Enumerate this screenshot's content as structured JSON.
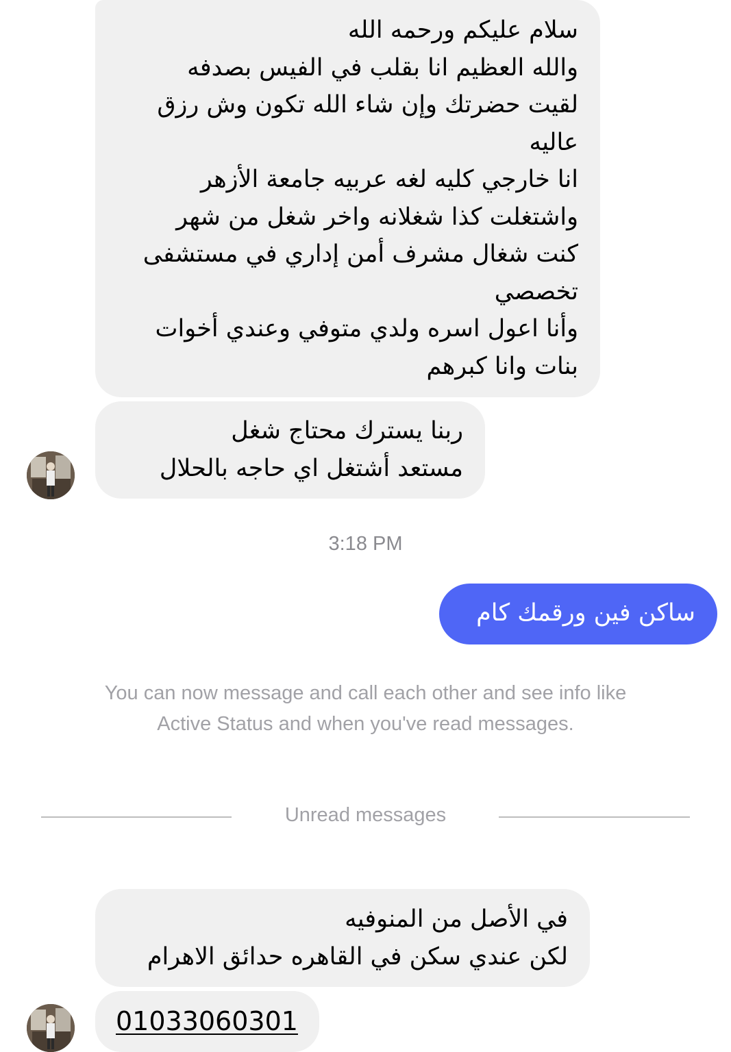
{
  "messages": {
    "incoming_1": {
      "lines": [
        "سلام عليكم ورحمه الله",
        "والله العظيم انا بقلب في الفيس بصدفه",
        "لقيت حضرتك وإن شاء الله تكون وش رزق",
        "عاليه",
        "انا خارجي كليه لغه عربيه جامعة الأزهر",
        "واشتغلت كذا شغلانه واخر شغل من شهر",
        "كنت شغال مشرف أمن إداري في مستشفى",
        "تخصصي",
        "وأنا اعول اسره ولدي متوفي وعندي أخوات",
        "بنات وانا كبرهم"
      ]
    },
    "incoming_2": {
      "lines": [
        "ربنا يسترك محتاج شغل",
        "مستعد أشتغل اي حاجه بالحلال"
      ]
    },
    "timestamp": "3:18 PM",
    "outgoing_1": "ساكن فين ورقمك كام",
    "system_notice": {
      "line1": "You can now message and call each other and see info like",
      "line2": "Active Status and when you've read messages."
    },
    "unread_divider": "Unread messages",
    "incoming_3": {
      "lines": [
        "في الأصل من المنوفيه",
        "لكن عندي سكن في القاهره حدائق الاهرام"
      ]
    },
    "incoming_4_phone": "01033060301"
  },
  "colors": {
    "incoming_bubble": "#f0f0f0",
    "outgoing_bubble": "#4f66f6",
    "meta_text": "#8a8a8f"
  }
}
